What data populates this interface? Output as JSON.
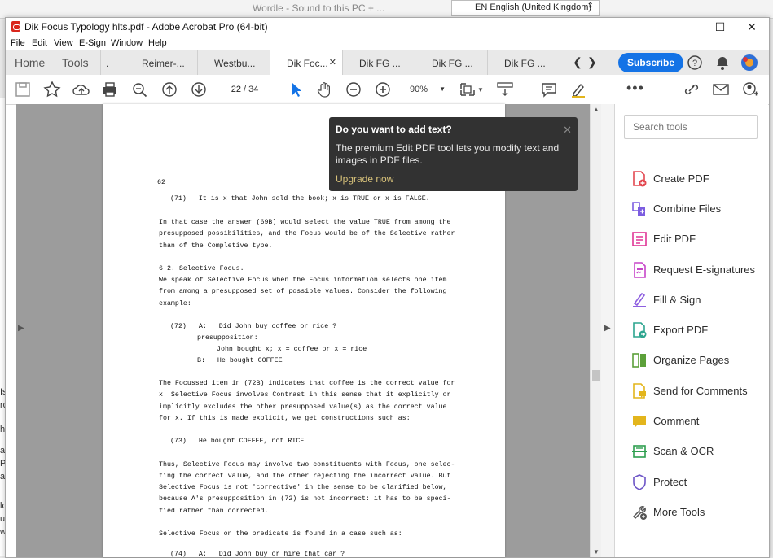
{
  "background": {
    "behind_title": "Wordle - Sound to this PC + ...",
    "language": "EN English (United Kingdom)",
    "left_strip": [
      "Is",
      "rd",
      "hi",
      "a",
      "Pr",
      "ar",
      "lo",
      "ur",
      "w"
    ]
  },
  "window": {
    "title": "Dik Focus Typology hlts.pdf - Adobe Acrobat Pro (64-bit)",
    "controls": {
      "minimize": "—",
      "maximize": "☐",
      "close": "✕"
    }
  },
  "menu": {
    "file": "File",
    "edit": "Edit",
    "view": "View",
    "esign": "E-Sign",
    "window": "Window",
    "help": "Help"
  },
  "tabs": {
    "home": "Home",
    "tools": "Tools",
    "docs": [
      {
        "label": "."
      },
      {
        "label": "Reimer-..."
      },
      {
        "label": "Westbu..."
      },
      {
        "label": "Dik Foc...",
        "close": "✕"
      },
      {
        "label": "Dik FG ..."
      },
      {
        "label": "Dik FG ..."
      },
      {
        "label": "Dik FG ..."
      }
    ],
    "subscribe": "Subscribe"
  },
  "toolbar": {
    "page_current": "22",
    "page_total": "/ 34",
    "zoom": "90%"
  },
  "document": {
    "page_number": "62",
    "lines": [
      "(71)   It is x that John sold the book; x is TRUE or x is FALSE.",
      "In that case the answer (69B) would select the value TRUE from among the",
      "presupposed possibilities, and the Focus would be of the Selective rather",
      "than of the Completive type.",
      "6.2. Selective Focus.",
      "We speak of Selective Focus when the Focus information selects one item",
      "from among a presupposed set of possible values. Consider the following",
      "example:",
      "(72)   A:   Did John buy coffee or rice ?",
      "presupposition:",
      "John bought x; x = coffee or x = rice",
      "B:   He bought COFFEE",
      "The Focussed item in (72B) indicates that coffee is the correct value for",
      "x. Selective Focus involves Contrast in this sense that it explicitly or",
      "implicitly excludes the other presupposed value(s) as the correct value",
      "for x. If this is made explicit, we get constructions such as:",
      "(73)   He bought COFFEE, not RICE",
      "Thus, Selective Focus may involve two constituents with Focus, one selec-",
      "ting the correct value, and the other rejecting the incorrect value. But",
      "Selective Focus is not 'corrective' in the sense to be clarified below,",
      "because A's presupposition in (72) is not incorrect: it has to be speci-",
      "fied rather than corrected.",
      "Selective Focus on the predicate is found in a case such as:",
      "(74)   A:   Did John buy or hire that car ?"
    ]
  },
  "popup": {
    "heading": "Do you want to add text?",
    "body": "The premium Edit PDF tool lets you modify text and images in PDF files.",
    "link": "Upgrade now",
    "close": "✕"
  },
  "tools_panel": {
    "search_placeholder": "Search tools",
    "items": [
      {
        "label": "Create PDF",
        "color": "#e34850"
      },
      {
        "label": "Combine Files",
        "color": "#7c5de0"
      },
      {
        "label": "Edit PDF",
        "color": "#e03596"
      },
      {
        "label": "Request E-signatures",
        "color": "#c745c9"
      },
      {
        "label": "Fill & Sign",
        "color": "#8e5fe0"
      },
      {
        "label": "Export PDF",
        "color": "#2da58f"
      },
      {
        "label": "Organize Pages",
        "color": "#5ca03a"
      },
      {
        "label": "Send for Comments",
        "color": "#e3b51c"
      },
      {
        "label": "Comment",
        "color": "#e3b51c"
      },
      {
        "label": "Scan & OCR",
        "color": "#2e9e4f"
      },
      {
        "label": "Protect",
        "color": "#6d55c7"
      },
      {
        "label": "More Tools",
        "color": "#555555"
      }
    ]
  }
}
